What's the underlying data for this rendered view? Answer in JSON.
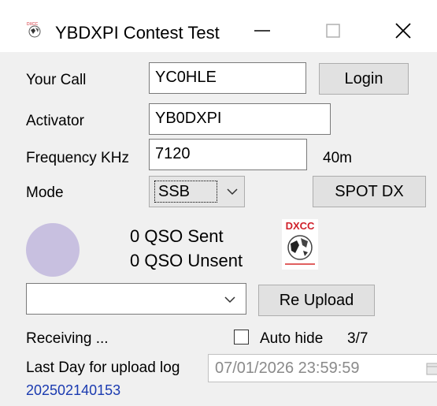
{
  "window": {
    "title": "YBDXPI Contest Test",
    "controls": [
      "minimize",
      "maximize",
      "close"
    ]
  },
  "form": {
    "your_call": {
      "label": "Your Call",
      "value": "YC0HLE"
    },
    "activator": {
      "label": "Activator",
      "value": "YB0DXPI"
    },
    "frequency": {
      "label": "Frequency KHz",
      "value": "7120",
      "band": "40m"
    },
    "mode": {
      "label": "Mode",
      "value": "SSB"
    }
  },
  "buttons": {
    "login": "Login",
    "spot_dx": "SPOT DX",
    "re_upload": "Re Upload"
  },
  "status": {
    "qso_sent": "0 QSO Sent",
    "qso_unsent": "0 QSO Unsent",
    "indicator_color": "#c8c0e0",
    "receiving": "Receiving ...",
    "auto_hide_label": "Auto hide",
    "auto_hide_checked": false,
    "counter": "3/7"
  },
  "upload_combo": {
    "value": ""
  },
  "deadline": {
    "label": "Last Day for upload  log",
    "value": "07/01/2026 23:59:59"
  },
  "version": "202502140153",
  "logo": {
    "text": "DXCC",
    "icon": "dxcc-globe-logo"
  }
}
